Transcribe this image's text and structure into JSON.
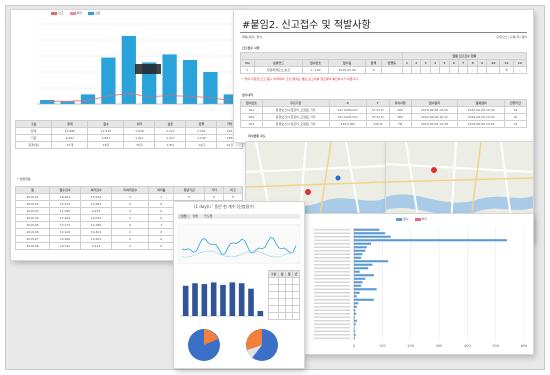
{
  "report": {
    "title": "#붙임2. 신고접수 및 적발사항",
    "subtitle_left": "제목(제출) 양식",
    "subtitle_right": "단위(건) | 출처(주) 센터",
    "section_summary": "신고접수 사항",
    "section_detail": "접수내역",
    "section_map": "위치현황 지도",
    "summary_head": [
      "No",
      "분류코드",
      "접수번호",
      "접수일",
      "합계",
      "진행중",
      "1",
      "2",
      "3",
      "4",
      "5",
      "6",
      "7",
      "8",
      "9",
      "10",
      "11",
      "12"
    ],
    "summary_group_head": "월별 신고건수 현황",
    "summary_row": [
      "1",
      "환경위해요소/보건",
      "1~100",
      "2018.03.06",
      "8",
      "-",
      "-",
      "-",
      "-",
      "-",
      "-",
      "-",
      "-",
      "-",
      "-",
      "-",
      "8",
      "-"
    ],
    "summary_note": "* 위의 사항은 신고 접수 내역이며, 조치 결과는 별도 보고서를 참조하여 확인하시기 바랍니다.",
    "detail_head": [
      "접수번호",
      "주요기관",
      "X",
      "Y",
      "특이사항",
      "접수일자",
      "결과일자",
      "진행기간"
    ],
    "detail_rows": [
      [
        "001",
        "환경보건/수질관리_오염원_기타",
        "127.0346 kml",
        "37.52 N",
        "WN",
        "2019-06-08 10:05",
        "2019-06-08 10:09",
        "03"
      ],
      [
        "002",
        "환경보건/수질관리_오염원_기타",
        "127.0345 kml",
        "37.52 N",
        "WN",
        "2019-06-08 10:12",
        "2019-06-09 10:34",
        "04"
      ],
      [
        "003",
        "환경보건/수질관리_오염원_기타",
        "126.9 NN",
        "126.N",
        "TN",
        "2019-06-08 10:18",
        "2019-06-08 12:01",
        "03"
      ]
    ]
  },
  "left_panel": {
    "legend": [
      "신고",
      "처리",
      "검토"
    ],
    "legend_colors": [
      "#e06a76",
      "#f08ca0",
      "#2aa3da"
    ],
    "summary_head": [
      "구분",
      "총계",
      "접수",
      "처리",
      "검토",
      "진행",
      "기타"
    ],
    "summary_rows": [
      [
        "합계",
        "14,880",
        "12,534",
        "1,936",
        "2,213",
        "1,187",
        "221"
      ],
      [
        "기관",
        "6,941",
        "2,811",
        "1,411",
        "1,417",
        "1,236",
        "283"
      ]
    ],
    "summary_sub": [
      "합계(월)",
      "47개",
      "18건",
      "35건",
      "1.8%",
      "14건",
      "12건"
    ],
    "section_label": "* 월별현황",
    "month_head": [
      "월",
      "접수건수",
      "처리건수",
      "미처리건수",
      "처리율",
      "평균기간",
      "기타",
      "비고"
    ],
    "month_rows": [
      [
        "2019.01",
        "18,401",
        "13,244",
        "0",
        "1",
        "0",
        "0",
        "0"
      ],
      [
        "2019.02",
        "12,415",
        "10,381",
        "0",
        "0",
        "0",
        "0",
        "0"
      ],
      [
        "2019.03",
        "11,020",
        "9,215",
        "0",
        "0",
        "1",
        "0",
        "0"
      ],
      [
        "2019.04",
        "11,402",
        "10,014",
        "0",
        "0",
        "0",
        "0",
        "0"
      ],
      [
        "2019.05",
        "13,171",
        "11,080",
        "0",
        "1",
        "0",
        "0",
        "0"
      ],
      [
        "2019.06",
        "12,104",
        "10,401",
        "0",
        "0",
        "0",
        "0",
        "0"
      ],
      [
        "2019.07",
        "14,200",
        "12,811",
        "0",
        "0",
        "0",
        "0",
        "0"
      ],
      [
        "2019.08",
        "10,310",
        "9,112",
        "0",
        "0",
        "0",
        "0",
        "0"
      ]
    ]
  },
  "dashboard": {
    "title": "(1 day)n ' 동안 현 개수 (신청접수)",
    "tabs": [
      "일별",
      "월별",
      "연도별"
    ],
    "table_head": [
      "구분",
      "일",
      "월",
      "년"
    ],
    "pie_colors": [
      "#3b6fc8",
      "#f0803a",
      "#e2e2e2"
    ]
  },
  "hbar_panel": {
    "legend": [
      "접수",
      "처리"
    ],
    "legend_colors": [
      "#5b9bd5",
      "#e06a76"
    ],
    "x_ticks": [
      "0",
      "100",
      "200",
      "300",
      "400",
      "500",
      "600"
    ]
  },
  "chart_data": [
    {
      "type": "bar",
      "series": [
        {
          "name": "검토",
          "values": [
            5,
            3,
            12,
            58,
            85,
            52,
            62,
            55,
            40,
            12
          ]
        }
      ],
      "categories": [
        "",
        "",
        "",
        "",
        "",
        "",
        "",
        "",
        "",
        ""
      ],
      "ylim": [
        0,
        100
      ]
    },
    {
      "type": "bar",
      "categories": [
        "",
        "",
        "",
        "",
        "",
        "",
        "",
        "",
        ""
      ],
      "values": [
        72,
        78,
        76,
        80,
        74,
        80,
        78,
        65,
        12
      ],
      "ylim": [
        0,
        100
      ]
    },
    {
      "type": "bar",
      "orientation": "horizontal",
      "categories": [
        "",
        "",
        "",
        "",
        "",
        "",
        "",
        "",
        "",
        "",
        "",
        "",
        "",
        "",
        "",
        "",
        "",
        "",
        "",
        "",
        "",
        "",
        "",
        "",
        "",
        "",
        "",
        "",
        "",
        "",
        "",
        ""
      ],
      "values": [
        90,
        110,
        130,
        540,
        60,
        45,
        40,
        30,
        25,
        120,
        65,
        50,
        20,
        70,
        40,
        30,
        25,
        80,
        20,
        10,
        70,
        15,
        10,
        5,
        8,
        3,
        10,
        6,
        2,
        4,
        6,
        3
      ],
      "xlim": [
        0,
        600
      ]
    }
  ]
}
